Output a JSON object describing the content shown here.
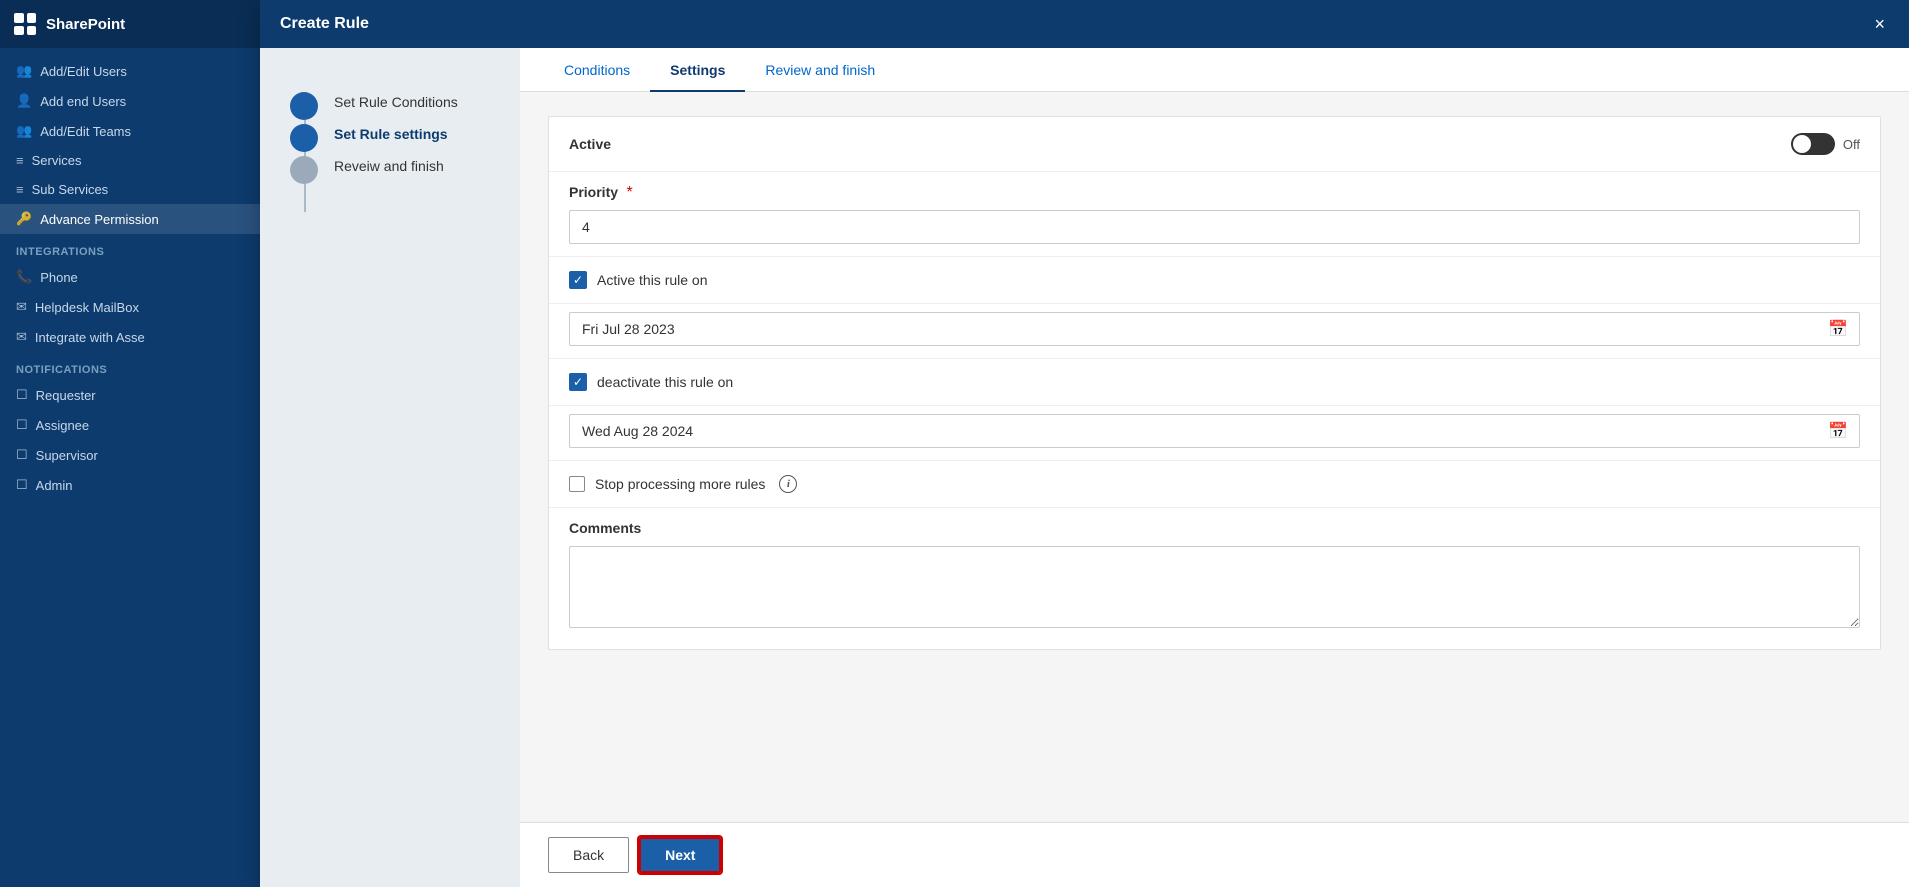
{
  "app": {
    "name": "SharePoint"
  },
  "sidebar": {
    "sections": [
      {
        "label": "Integrations",
        "items": [
          {
            "icon": "📞",
            "label": "Phone"
          },
          {
            "icon": "✉",
            "label": "Helpdesk MailBox"
          },
          {
            "icon": "✉",
            "label": "Integrate with Asse"
          }
        ]
      },
      {
        "label": "Notifications",
        "items": [
          {
            "icon": "☐",
            "label": "Requester"
          },
          {
            "icon": "☐",
            "label": "Assignee"
          },
          {
            "icon": "☐",
            "label": "Supervisor"
          },
          {
            "icon": "☐",
            "label": "Admin"
          }
        ]
      }
    ],
    "top_items": [
      {
        "icon": "👥",
        "label": "Add/Edit Users"
      },
      {
        "icon": "👤",
        "label": "Add end Users"
      },
      {
        "icon": "👥",
        "label": "Add/Edit Teams"
      },
      {
        "icon": "⚙",
        "label": "Services"
      },
      {
        "icon": "⚙",
        "label": "Sub Services"
      },
      {
        "icon": "🔑",
        "label": "Advance Permission"
      }
    ]
  },
  "dialog": {
    "title": "Create Rule",
    "close_label": "×",
    "steps": [
      {
        "label": "Set Rule Conditions",
        "state": "completed"
      },
      {
        "label": "Set Rule settings",
        "state": "active"
      },
      {
        "label": "Reveiw and finish",
        "state": "inactive"
      }
    ],
    "tabs": [
      {
        "label": "Conditions",
        "active": false
      },
      {
        "label": "Settings",
        "active": true
      },
      {
        "label": "Review and finish",
        "active": false
      }
    ],
    "form": {
      "active_label": "Active",
      "toggle_state": "off",
      "toggle_text": "Off",
      "priority_label": "Priority",
      "priority_required": "*",
      "priority_value": "4",
      "active_rule_on_label": "Active this rule on",
      "active_rule_on_checked": true,
      "active_date_value": "Fri Jul 28 2023",
      "deactivate_label": "deactivate this rule on",
      "deactivate_checked": true,
      "deactivate_date_value": "Wed Aug 28 2024",
      "stop_processing_label": "Stop processing more rules",
      "stop_processing_checked": false,
      "comments_label": "Comments",
      "comments_value": "",
      "comments_placeholder": ""
    },
    "footer": {
      "back_label": "Back",
      "next_label": "Next"
    }
  }
}
